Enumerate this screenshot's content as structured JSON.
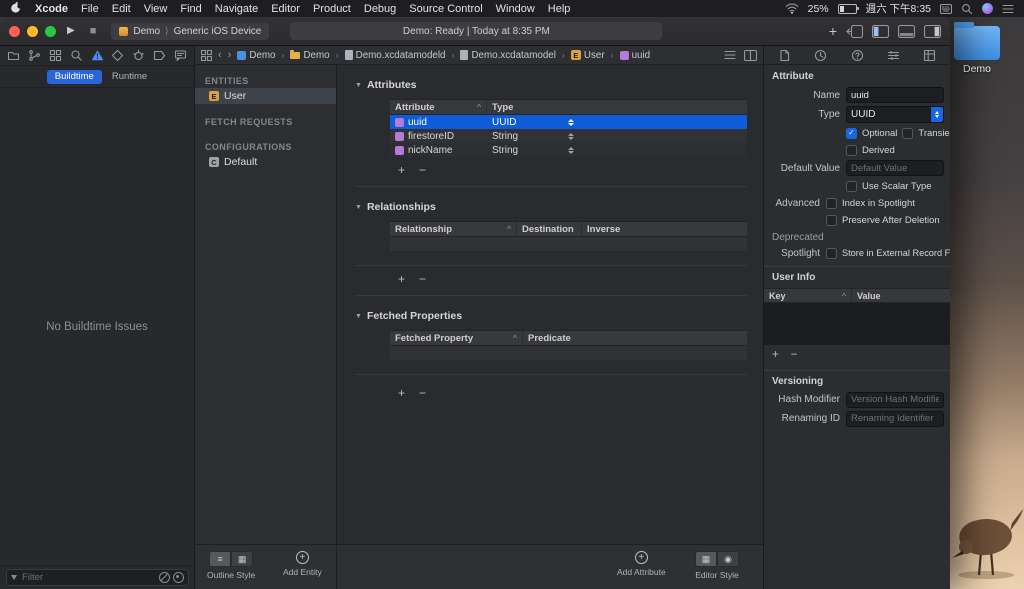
{
  "glyphs": {
    "disclosure": "▼",
    "plus": "+",
    "minus": "−",
    "back": "‹",
    "forward": "›",
    "crumb_sep": "›",
    "sort": "^",
    "check": "✓",
    "play": "▶",
    "stop": "■",
    "list": "≡",
    "grid": "▦",
    "graph": "◉",
    "scheme_sep": "⟩"
  },
  "menu_bar": {
    "items": [
      "Xcode",
      "File",
      "Edit",
      "View",
      "Find",
      "Navigate",
      "Editor",
      "Product",
      "Debug",
      "Source Control",
      "Window",
      "Help"
    ],
    "battery": "25%",
    "clock": "週六 下午8:35"
  },
  "toolbar": {
    "scheme_name": "Demo",
    "scheme_destination": "Generic iOS Device",
    "activity": "Demo: Ready | Today at 8:35 PM"
  },
  "navigator": {
    "buildtime_tab": "Buildtime",
    "runtime_tab": "Runtime",
    "empty_message": "No Buildtime Issues",
    "filter_placeholder": "Filter"
  },
  "entity_panel": {
    "entities_header": "ENTITIES",
    "fetch_requests_header": "FETCH REQUESTS",
    "configurations_header": "CONFIGURATIONS",
    "entity_badge": "E",
    "entity_name": "User",
    "config_badge": "C",
    "config_name": "Default",
    "outline_style_label": "Outline Style",
    "add_entity_label": "Add Entity"
  },
  "jump_bar": {
    "crumbs": [
      "Demo",
      "Demo",
      "Demo.xcdatamodeld",
      "Demo.xcdatamodel",
      "User",
      "uuid"
    ]
  },
  "editor": {
    "attributes": {
      "title": "Attributes",
      "col_attribute": "Attribute",
      "col_type": "Type",
      "rows": [
        {
          "name": "uuid",
          "type": "UUID"
        },
        {
          "name": "firestoreID",
          "type": "String"
        },
        {
          "name": "nickName",
          "type": "String"
        }
      ]
    },
    "relationships": {
      "title": "Relationships",
      "col_relationship": "Relationship",
      "col_destination": "Destination",
      "col_inverse": "Inverse"
    },
    "fetched": {
      "title": "Fetched Properties",
      "col_property": "Fetched Property",
      "col_predicate": "Predicate"
    },
    "add_attribute_label": "Add Attribute",
    "editor_style_label": "Editor Style"
  },
  "inspector": {
    "title": "Attribute",
    "name_label": "Name",
    "name_value": "uuid",
    "type_label": "Type",
    "type_value": "UUID",
    "optional": "Optional",
    "transient": "Transient",
    "derived": "Derived",
    "default_value_label": "Default Value",
    "default_value_placeholder": "Default Value",
    "use_scalar": "Use Scalar Type",
    "advanced_label": "Advanced",
    "index_in_spotlight": "Index in Spotlight",
    "preserve_after_deletion": "Preserve After Deletion",
    "deprecated_label": "Deprecated",
    "spotlight_label": "Spotlight",
    "store_external": "Store in External Record File",
    "user_info_title": "User Info",
    "key_header": "Key",
    "value_header": "Value",
    "versioning_title": "Versioning",
    "hash_label": "Hash Modifier",
    "hash_placeholder": "Version Hash Modifier",
    "renaming_label": "Renaming ID",
    "renaming_placeholder": "Renaming Identifier"
  },
  "desktop": {
    "folder_label": "Demo"
  }
}
